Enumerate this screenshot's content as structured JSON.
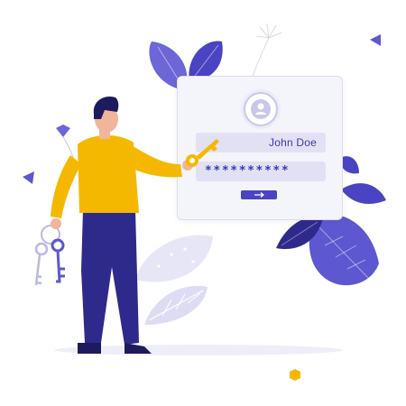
{
  "login": {
    "username_value": "John Doe",
    "password_value": "**********"
  },
  "icons": {
    "avatar": "user-icon",
    "submit": "arrow-right-icon",
    "key": "key-icon"
  },
  "colors": {
    "primary": "#4a44c2",
    "accent_yellow": "#f5b800",
    "card_bg": "#f4f4fb",
    "field_bg": "#e2e1f4",
    "trousers": "#2e2a8c"
  }
}
